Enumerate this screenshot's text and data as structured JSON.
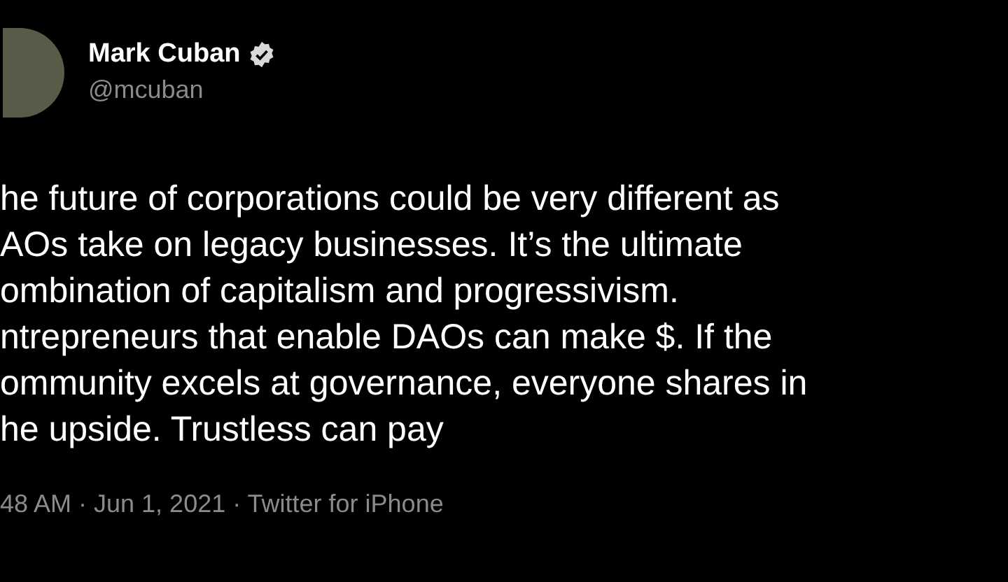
{
  "author": {
    "name": "Mark Cuban",
    "verified": true,
    "handle": "@mcuban"
  },
  "tweet": {
    "lines": [
      "he future of corporations could be very different as",
      "AOs take on legacy businesses. It’s the ultimate",
      "ombination of capitalism and progressivism.",
      "ntrepreneurs that enable DAOs can make $. If the",
      "ommunity excels at governance, everyone shares in",
      "he upside. Trustless can pay"
    ]
  },
  "meta": "48 AM · Jun 1, 2021 · Twitter for iPhone"
}
